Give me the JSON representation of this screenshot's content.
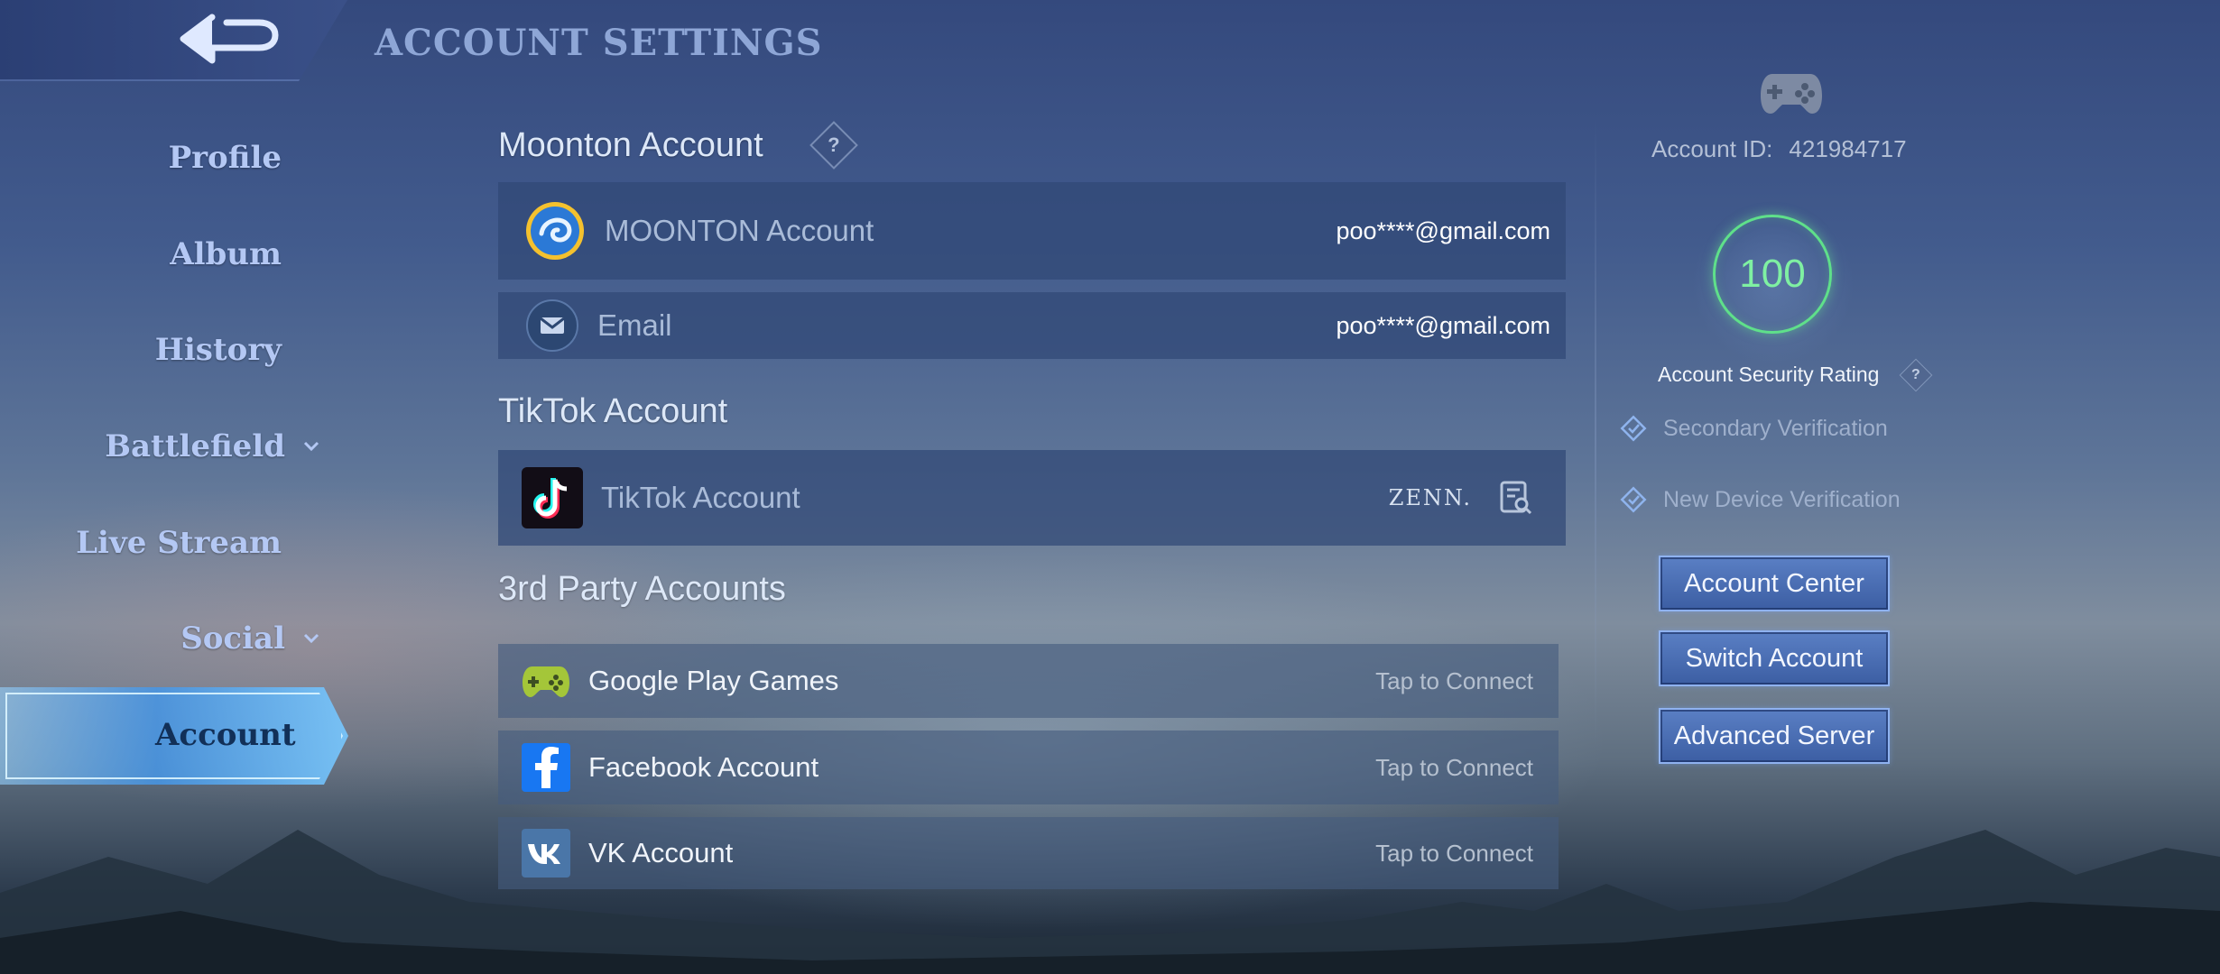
{
  "header": {
    "title": "ACCOUNT SETTINGS",
    "back_icon": "back-arrow-icon"
  },
  "nav": {
    "items": [
      {
        "label": "Profile",
        "has_chevron": false
      },
      {
        "label": "Album",
        "has_chevron": false
      },
      {
        "label": "History",
        "has_chevron": false
      },
      {
        "label": "Battlefield",
        "has_chevron": true
      },
      {
        "label": "Live Stream",
        "has_chevron": false
      },
      {
        "label": "Social",
        "has_chevron": true
      }
    ],
    "active": {
      "label": "Account"
    }
  },
  "moonton": {
    "title": "Moonton Account",
    "help_label": "?",
    "rows": [
      {
        "icon": "moonton-logo-icon",
        "label": "MOONTON Account",
        "value": "poo****@gmail.com"
      },
      {
        "icon": "email-icon",
        "label": "Email",
        "value": "poo****@gmail.com"
      }
    ]
  },
  "tiktok": {
    "title": "TikTok Account",
    "row": {
      "icon": "tiktok-logo-icon",
      "label": "TikTok Account",
      "value": "ZENN.",
      "action_icon": "search-document-icon"
    }
  },
  "third_party": {
    "title": "3rd Party Accounts",
    "rows": [
      {
        "icon": "google-play-games-icon",
        "label": "Google Play Games",
        "value": "Tap to Connect"
      },
      {
        "icon": "facebook-icon",
        "label": "Facebook Account",
        "value": "Tap to Connect"
      },
      {
        "icon": "vk-icon",
        "label": "VK Account",
        "value": "Tap to Connect"
      }
    ]
  },
  "side": {
    "account_id_label": "Account ID:",
    "account_id": "421984717",
    "rating": "100",
    "rating_label": "Account Security Rating",
    "help_label": "?",
    "verifications": [
      "Secondary Verification",
      "New Device Verification"
    ],
    "buttons": [
      "Account Center",
      "Switch Account",
      "Advanced Server"
    ]
  },
  "colors": {
    "accent": "#5fe08a",
    "nav_text": "#b4c8f4",
    "button": "#4a6cb4"
  }
}
